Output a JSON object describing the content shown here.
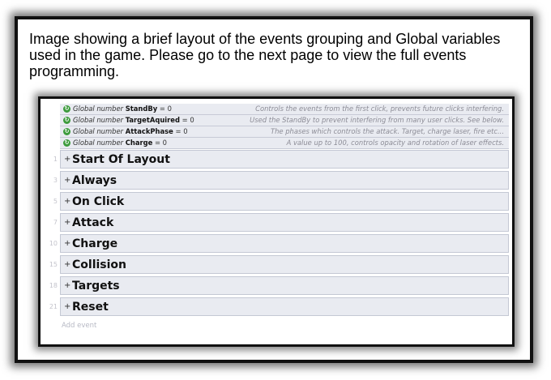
{
  "caption": "Image showing a brief layout of the events grouping and Global variables used in the game. Please go to the next page to view the full events programming.",
  "global_vars": [
    {
      "kind": "Global number",
      "name": "StandBy",
      "value": "= 0",
      "comment": "Controls the events from the first click, prevents future clicks interfering."
    },
    {
      "kind": "Global number",
      "name": "TargetAquired",
      "value": "= 0",
      "comment": "Used the StandBy to prevent interfering from many user clicks. See below."
    },
    {
      "kind": "Global number",
      "name": "AttackPhase",
      "value": "= 0",
      "comment": "The phases which controls the attack. Target, charge laser, fire etc..."
    },
    {
      "kind": "Global number",
      "name": "Charge",
      "value": "= 0",
      "comment": "A value up to 100, controls opacity and rotation of laser effects."
    }
  ],
  "groups": [
    {
      "line": "1",
      "title": "Start Of Layout"
    },
    {
      "line": "3",
      "title": "Always"
    },
    {
      "line": "5",
      "title": "On Click"
    },
    {
      "line": "7",
      "title": "Attack"
    },
    {
      "line": "10",
      "title": "Charge"
    },
    {
      "line": "15",
      "title": "Collision"
    },
    {
      "line": "18",
      "title": "Targets"
    },
    {
      "line": "21",
      "title": "Reset"
    }
  ],
  "expand_symbol": "+",
  "var_icon_symbol": "↻",
  "add_event_label": "Add event",
  "colors": {
    "row_bg": "#e9ebf1",
    "row_border": "#c4c8d4",
    "icon_green": "#3c9b3c",
    "comment_text": "#8c8c96"
  }
}
